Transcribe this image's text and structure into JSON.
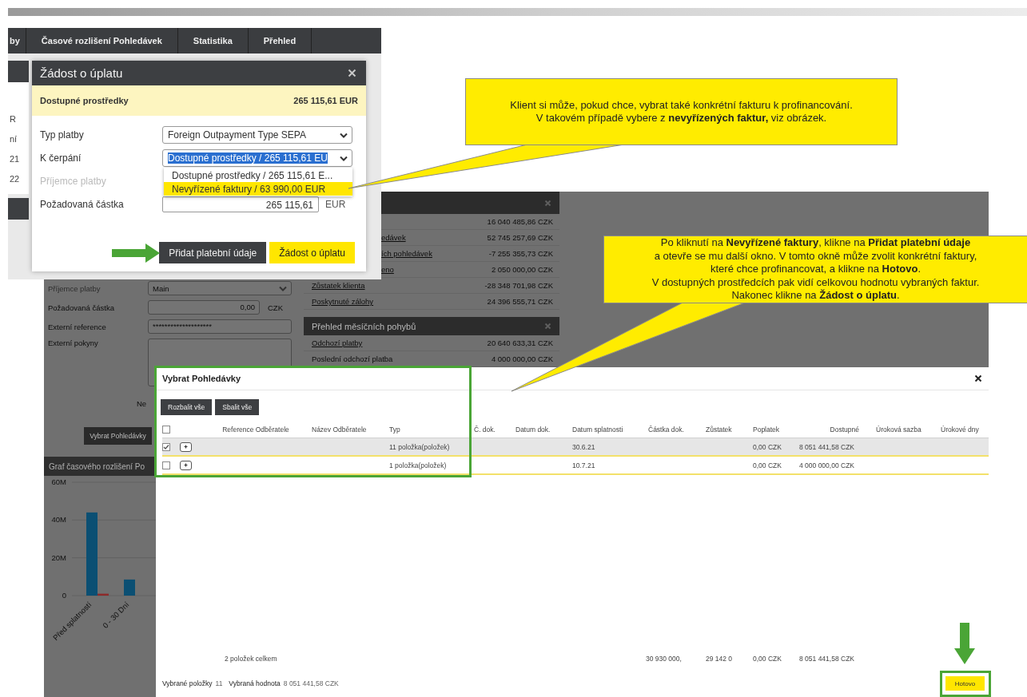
{
  "tab_bar": {
    "tabs": [
      {
        "label": "by",
        "selected": false
      },
      {
        "label": "Časové rozlišení Pohledávek",
        "selected": false
      },
      {
        "label": "Statistika",
        "selected": false
      },
      {
        "label": "Přehled",
        "selected": false
      }
    ]
  },
  "background_cells": [
    "R",
    "ní",
    "21",
    "22"
  ],
  "payment_dialog": {
    "title": "Žádost o úplatu",
    "available": {
      "label": "Dostupné prostředky",
      "value": "265 115,61 EUR"
    },
    "fields": [
      {
        "kind": "select",
        "label": "Typ platby",
        "value": "Foreign Outpayment Type SEPA",
        "disabled": false,
        "highlighted": false
      },
      {
        "kind": "select",
        "label": "K čerpání",
        "value": "Dostupné prostředky / 265 115,61 EU",
        "disabled": false,
        "highlighted": true
      },
      {
        "kind": "label",
        "label": "Příjemce platby",
        "disabled": true
      },
      {
        "kind": "amount",
        "label": "Požadovaná částka",
        "value": "265 115,61",
        "unit": "EUR",
        "disabled": false
      }
    ],
    "dropdown": {
      "options": [
        {
          "label": "Dostupné prostředky / 265 115,61 E...",
          "selected": false
        },
        {
          "label": "Nevyřízené faktury / 63 990,00 EUR",
          "selected": true
        }
      ]
    },
    "buttons": [
      {
        "kind": "secondary",
        "label": "Přidat platební údaje"
      },
      {
        "kind": "primary",
        "label": "Žádost o úplatu"
      }
    ]
  },
  "background_app": {
    "form": {
      "fields": [
        {
          "kind": "select",
          "label": "Příjemce platby",
          "value": "Main",
          "disabled": true
        },
        {
          "kind": "amount",
          "label": "Požadovaná částka",
          "value": "0,00",
          "unit": "CZK",
          "disabled": false
        },
        {
          "kind": "text",
          "label": "Externí reference",
          "value": "********************",
          "disabled": false
        },
        {
          "kind": "textarea",
          "label": "Externí pokyny",
          "disabled": false
        }
      ],
      "partial_label": "Ne",
      "button": "Vybrat Pohledávky"
    },
    "chart_panel": {
      "title": "Graf časového rozlišení Po",
      "chart_data": {
        "type": "bar",
        "categories": [
          "Před splatností",
          "0 - 30 Dní"
        ],
        "series": [
          {
            "color": "#0b4f73",
            "values": [
              44000000,
              8500000
            ]
          },
          {
            "color": "#8e2a2a",
            "values": [
              1000000,
              0
            ]
          }
        ],
        "ylim": [
          0,
          60000000
        ],
        "yticks": [
          {
            "value": 0,
            "label": "0"
          },
          {
            "value": 20000000,
            "label": "20M"
          },
          {
            "value": 40000000,
            "label": "40M"
          },
          {
            "value": 60000000,
            "label": "60M"
          }
        ]
      }
    },
    "summary_panel": {
      "rows": [
        {
          "value": "16 040 485,86 CZK"
        },
        {
          "label": "edávek",
          "value": "52 745 257,69 CZK",
          "link": true
        },
        {
          "label": "ích pohledávek",
          "value": "-7 255 355,73 CZK",
          "link": true
        },
        {
          "label": "eno",
          "value": "2 050 000,00 CZK",
          "link": true
        },
        {
          "label": "Zůstatek klienta",
          "value": "-28 348 701,98 CZK",
          "link": true
        },
        {
          "label": "Poskytnuté zálohy",
          "value": "24 396 555,71 CZK",
          "link": true
        }
      ]
    },
    "movements_panel": {
      "title": "Přehled měsíčních pohybů",
      "rows": [
        {
          "label": "Odchozí platby",
          "value": "20 640 633,31 CZK",
          "link": true
        },
        {
          "label": "Poslední odchozí platba",
          "value": "4 000 000,00 CZK",
          "link": false
        }
      ]
    }
  },
  "select_modal": {
    "title": "Vybrat Pohledávky",
    "buttons": [
      "Rozbalit vše",
      "Sbalit vše"
    ],
    "table": {
      "all_checked": false,
      "columns": [
        "Reference Odběratele",
        "Název Odběratele",
        "Typ",
        "Č. dok.",
        "Datum dok.",
        "Datum splatnosti",
        "Částka dok.",
        "Zůstatek",
        "Poplatek",
        "Dostupné",
        "Úroková sazba",
        "Úrokové dny"
      ],
      "rows": [
        {
          "selected": true,
          "checked": true,
          "type": "11 položka(položek)",
          "due_date": "30.6.21",
          "fee": "0,00 CZK",
          "available": "8 051 441,58 CZK"
        },
        {
          "selected": false,
          "checked": false,
          "type": "1 položka(položek)",
          "due_date": "10.7.21",
          "fee": "0,00 CZK",
          "available": "4 000 000,00 CZK"
        }
      ],
      "total": {
        "label": "2 položek celkem",
        "amount": "30 930 000,",
        "balance": "29 142 0",
        "fee": "0,00 CZK",
        "available": "8 051 441,58 CZK"
      }
    },
    "status": {
      "items_label": "Vybrané položky",
      "items_value": "11",
      "value_label": "Vybraná hodnota",
      "value": "8 051 441,58 CZK"
    },
    "done_button": "Hotovo"
  },
  "callouts": [
    {
      "lines": [
        "Klient si může, pokud chce, vybrat také konkrétní fakturu k profinancování.",
        "V takovém případě vybere z **nevyřízených faktur,** viz obrázek."
      ]
    },
    {
      "lines": [
        "Po kliknutí na **Nevyřízené faktury**, klikne na **Přidat platební údaje**",
        "a otevře se mu další okno. V tomto okně může zvolit konkrétní faktury,",
        "které chce profinancovat, a klikne na **Hotovo**.",
        "V dostupných prostředcích pak vidí celkovou hodnotu vybraných faktur.",
        "Nakonec klikne na **Žádost o úplatu**."
      ]
    }
  ]
}
